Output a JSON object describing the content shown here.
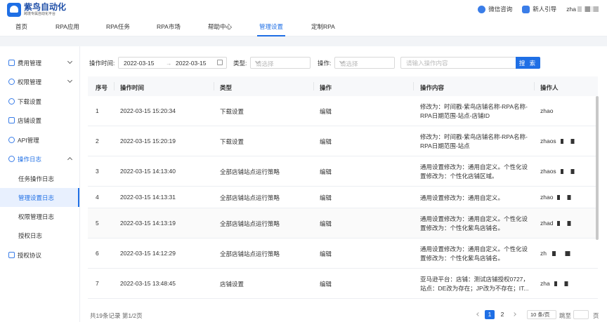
{
  "header": {
    "logo_title": "紫鸟自动化",
    "logo_subtitle": "跨境专属自动化平台",
    "wechat_label": "微信咨询",
    "guide_label": "新人引导",
    "user_name": "zha"
  },
  "nav": {
    "items": [
      {
        "label": "首页"
      },
      {
        "label": "RPA应用"
      },
      {
        "label": "RPA任务"
      },
      {
        "label": "RPA市场"
      },
      {
        "label": "帮助中心"
      },
      {
        "label": "管理设置"
      },
      {
        "label": "定制RPA"
      }
    ],
    "active": "管理设置"
  },
  "sidebar": {
    "items": [
      {
        "label": "费用管理"
      },
      {
        "label": "权限管理"
      },
      {
        "label": "下载设置"
      },
      {
        "label": "店铺设置"
      },
      {
        "label": "API管理"
      },
      {
        "label": "操作日志"
      },
      {
        "label": "授权协议"
      }
    ],
    "sub_items": [
      {
        "label": "任务操作日志"
      },
      {
        "label": "管理设置日志"
      },
      {
        "label": "权限管理日志"
      },
      {
        "label": "授权日志"
      }
    ],
    "active_sub": "管理设置日志"
  },
  "filters": {
    "time_label": "操作时间:",
    "date_start": "2022-03-15",
    "date_arrow": "→",
    "date_end": "2022-03-15",
    "type_label": "类型:",
    "type_placeholder": "请选择",
    "op_label": "操作:",
    "op_placeholder": "请选择",
    "search_placeholder": "请输入操作内容",
    "search_button": "搜 索"
  },
  "table": {
    "headers": [
      "序号",
      "操作时间",
      "类型",
      "操作",
      "操作内容",
      "操作人"
    ],
    "rows": [
      {
        "no": "1",
        "time": "2022-03-15 15:20:34",
        "type": "下载设置",
        "op": "编辑",
        "content": "修改为：时间戳-紫鸟店铺名称-RPA名称-RPA日期范围-站点-店铺ID",
        "user": "zhao"
      },
      {
        "no": "2",
        "time": "2022-03-15 15:20:19",
        "type": "下载设置",
        "op": "编辑",
        "content": "修改为：时间戳-紫鸟店铺名称-RPA名称-RPA日期范围-站点",
        "user": "zhaos"
      },
      {
        "no": "3",
        "time": "2022-03-15 14:13:40",
        "type": "全部店铺站点运行策略",
        "op": "编辑",
        "content": "通用设置修改为：通用自定义。个性化设置修改为：个性化店铺区域。",
        "user": "zhaos"
      },
      {
        "no": "4",
        "time": "2022-03-15 14:13:31",
        "type": "全部店铺站点运行策略",
        "op": "编辑",
        "content": "通用设置修改为：通用自定义。",
        "user": "zhao"
      },
      {
        "no": "5",
        "time": "2022-03-15 14:13:19",
        "type": "全部店铺站点运行策略",
        "op": "编辑",
        "content": "通用设置修改为：通用自定义。个性化设置修改为：个性化紫鸟店铺名。",
        "user": "zhad"
      },
      {
        "no": "6",
        "time": "2022-03-15 14:12:29",
        "type": "全部店铺站点运行策略",
        "op": "编辑",
        "content": "通用设置修改为：通用自定义。个性化设置修改为：个性化紫鸟店铺名。",
        "user": "zh"
      },
      {
        "no": "7",
        "time": "2022-03-15 13:48:45",
        "type": "店铺设置",
        "op": "编辑",
        "content": "亚马逊平台：店铺：测试店铺授权0727，站点：DE改为存在；JP改为不存在；IT...",
        "user": "zha"
      }
    ]
  },
  "pagination": {
    "total_text": "共19条记录 第1/2页",
    "pages": [
      "1",
      "2"
    ],
    "current": "1",
    "page_size": "10 条/页",
    "jump_label": "跳至",
    "page_unit": "页"
  },
  "colors": {
    "accent": "#1f6fe5"
  }
}
